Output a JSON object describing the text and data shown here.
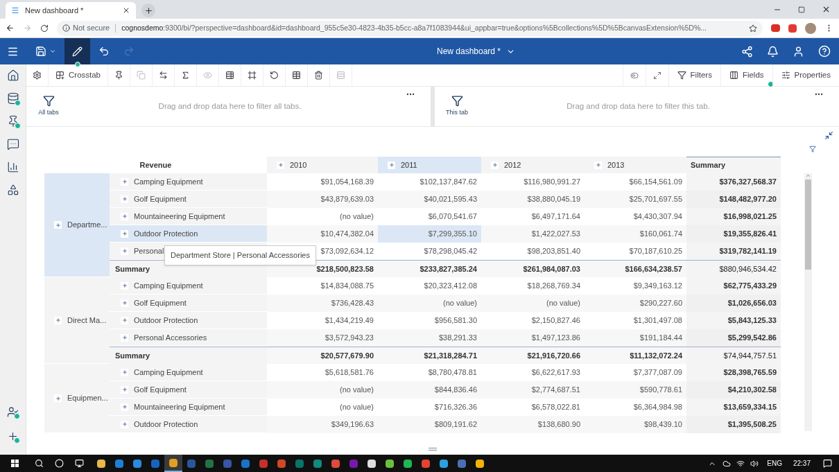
{
  "browser": {
    "tab": {
      "title": "New dashboard *"
    },
    "security": "Not secure",
    "url_host": "cognosdemo",
    "url_rest": ":9300/bi/?perspective=dashboard&id=dashboard_955c5e30-4823-4b35-b5cc-a8a7f1083944&ui_appbar=true&options%5Bcollections%5D%5BcanvasExtension%5D%..."
  },
  "appbar": {
    "title": "New dashboard *",
    "edit_mode": {
      "selected": true
    },
    "redo": {
      "disabled": true
    }
  },
  "sidebar": {
    "items": [
      {
        "kind": "home",
        "dot": false
      },
      {
        "kind": "data",
        "dot": true
      },
      {
        "kind": "pin",
        "dot": true
      },
      {
        "kind": "comment",
        "dot": false
      },
      {
        "kind": "chart",
        "dot": false
      },
      {
        "kind": "shapes",
        "dot": false
      }
    ],
    "bottom": [
      {
        "kind": "user",
        "dot": true
      },
      {
        "kind": "add",
        "dot": true
      }
    ]
  },
  "toolbar": {
    "items": [
      {
        "kind": "settings",
        "disabled": false
      },
      {
        "kind": "crosstab",
        "label": "Crosstab",
        "disabled": false
      },
      {
        "kind": "pin",
        "disabled": false
      },
      {
        "kind": "copy",
        "disabled": true
      },
      {
        "kind": "swap",
        "disabled": false
      },
      {
        "kind": "sum",
        "disabled": false
      },
      {
        "kind": "eye",
        "disabled": true
      },
      {
        "kind": "table-settings",
        "disabled": false
      },
      {
        "kind": "frame",
        "disabled": false
      },
      {
        "kind": "undo",
        "disabled": false
      },
      {
        "kind": "table",
        "disabled": false
      },
      {
        "kind": "trash",
        "disabled": false
      },
      {
        "kind": "insert",
        "disabled": true
      }
    ],
    "right": [
      {
        "kind": "toggle",
        "dot": false
      },
      {
        "kind": "expand",
        "dot": false
      },
      {
        "kind": "filter",
        "label": "Filters",
        "dot": false
      },
      {
        "kind": "fields",
        "label": "Fields",
        "dot": true
      },
      {
        "kind": "properties",
        "label": "Properties",
        "dot": false
      }
    ]
  },
  "filters": [
    {
      "label": "All tabs",
      "placeholder": "Drag and drop data here to filter all tabs."
    },
    {
      "label": "This tab",
      "placeholder": "Drag and drop data here to filter this tab."
    }
  ],
  "crosstab": {
    "measure": "Revenue",
    "tooltip": "Department Store | Personal Accessories",
    "columns": [
      {
        "label": "2010",
        "selected": false
      },
      {
        "label": "2011",
        "selected": true
      },
      {
        "label": "2012",
        "selected": false
      },
      {
        "label": "2013",
        "selected": false
      }
    ],
    "summary_header": "Summary",
    "groups": [
      {
        "label": "Departme...",
        "selected": true,
        "rows": [
          {
            "label": "Camping Equipment",
            "selected": false,
            "values": [
              "$91,054,168.39",
              "$102,137,847.62",
              "$116,980,991.27",
              "$66,154,561.09"
            ],
            "total": "$376,327,568.37"
          },
          {
            "label": "Golf Equipment",
            "selected": false,
            "values": [
              "$43,879,639.03",
              "$40,021,595.43",
              "$38,880,045.19",
              "$25,701,697.55"
            ],
            "total": "$148,482,977.20"
          },
          {
            "label": "Mountaineering Equipment",
            "selected": false,
            "values": [
              "(no value)",
              "$6,070,541.67",
              "$6,497,171.64",
              "$4,430,307.94"
            ],
            "total": "$16,998,021.25"
          },
          {
            "label": "Outdoor Protection",
            "selected": true,
            "values": [
              "$10,474,382.04",
              "$7,299,355.10",
              "$1,422,027.53",
              "$160,061.74"
            ],
            "total": "$19,355,826.41"
          },
          {
            "label": "Personal",
            "selected": false,
            "values": [
              "$73,092,634.12",
              "$78,298,045.42",
              "$98,203,851.40",
              "$70,187,610.25"
            ],
            "total": "$319,782,141.19"
          }
        ],
        "summary": {
          "label": "Summary",
          "values": [
            "$218,500,823.58",
            "$233,827,385.24",
            "$261,984,087.03",
            "$166,634,238.57"
          ],
          "total": "$880,946,534.42"
        }
      },
      {
        "label": "Direct Ma...",
        "selected": false,
        "rows": [
          {
            "label": "Camping Equipment",
            "selected": false,
            "values": [
              "$14,834,088.75",
              "$20,323,412.08",
              "$18,268,769.34",
              "$9,349,163.12"
            ],
            "total": "$62,775,433.29"
          },
          {
            "label": "Golf Equipment",
            "selected": false,
            "values": [
              "$736,428.43",
              "(no value)",
              "(no value)",
              "$290,227.60"
            ],
            "total": "$1,026,656.03"
          },
          {
            "label": "Outdoor Protection",
            "selected": false,
            "values": [
              "$1,434,219.49",
              "$956,581.30",
              "$2,150,827.46",
              "$1,301,497.08"
            ],
            "total": "$5,843,125.33"
          },
          {
            "label": "Personal Accessories",
            "selected": false,
            "values": [
              "$3,572,943.23",
              "$38,291.33",
              "$1,497,123.86",
              "$191,184.44"
            ],
            "total": "$5,299,542.86"
          }
        ],
        "summary": {
          "label": "Summary",
          "values": [
            "$20,577,679.90",
            "$21,318,284.71",
            "$21,916,720.66",
            "$11,132,072.24"
          ],
          "total": "$74,944,757.51"
        }
      },
      {
        "label": "Equipmen...",
        "selected": false,
        "rows": [
          {
            "label": "Camping Equipment",
            "selected": false,
            "values": [
              "$5,618,581.76",
              "$8,780,478.81",
              "$6,622,617.93",
              "$7,377,087.09"
            ],
            "total": "$28,398,765.59"
          },
          {
            "label": "Golf Equipment",
            "selected": false,
            "values": [
              "(no value)",
              "$844,836.46",
              "$2,774,687.51",
              "$590,778.61"
            ],
            "total": "$4,210,302.58"
          },
          {
            "label": "Mountaineering Equipment",
            "selected": false,
            "values": [
              "(no value)",
              "$716,326.36",
              "$6,578,022.81",
              "$6,364,984.98"
            ],
            "total": "$13,659,334.15"
          },
          {
            "label": "Outdoor Protection",
            "selected": false,
            "values": [
              "$349,196.63",
              "$809,191.62",
              "$138,680.90",
              "$98,439.10"
            ],
            "total": "$1,395,508.25"
          }
        ]
      }
    ]
  },
  "taskbar": {
    "apps": [
      {
        "color": "#e8b84a",
        "selected": false
      },
      {
        "color": "#1e7fd6",
        "selected": false
      },
      {
        "color": "#2a8be0",
        "selected": false
      },
      {
        "color": "#1565c0",
        "selected": false
      },
      {
        "color": "#e0a020",
        "selected": true
      },
      {
        "color": "#2b579a",
        "selected": false
      },
      {
        "color": "#217346",
        "selected": false
      },
      {
        "color": "#3955a3",
        "selected": false
      },
      {
        "color": "#1a73c8",
        "selected": false
      },
      {
        "color": "#c4302b",
        "selected": false
      },
      {
        "color": "#d24726",
        "selected": false
      },
      {
        "color": "#077568",
        "selected": false
      },
      {
        "color": "#0f8a7e",
        "selected": false
      },
      {
        "color": "#e04a3c",
        "selected": false
      },
      {
        "color": "#7719aa",
        "selected": false
      },
      {
        "color": "#dddddd",
        "selected": false
      },
      {
        "color": "#6cbf3c",
        "selected": false
      },
      {
        "color": "#1db954",
        "selected": false
      },
      {
        "color": "#e44332",
        "selected": false
      },
      {
        "color": "#2aa0e0",
        "selected": false
      },
      {
        "color": "#4a6fb5",
        "selected": false
      },
      {
        "color": "#f0b400",
        "selected": false
      }
    ],
    "language": "ENG",
    "time": "22:37"
  }
}
